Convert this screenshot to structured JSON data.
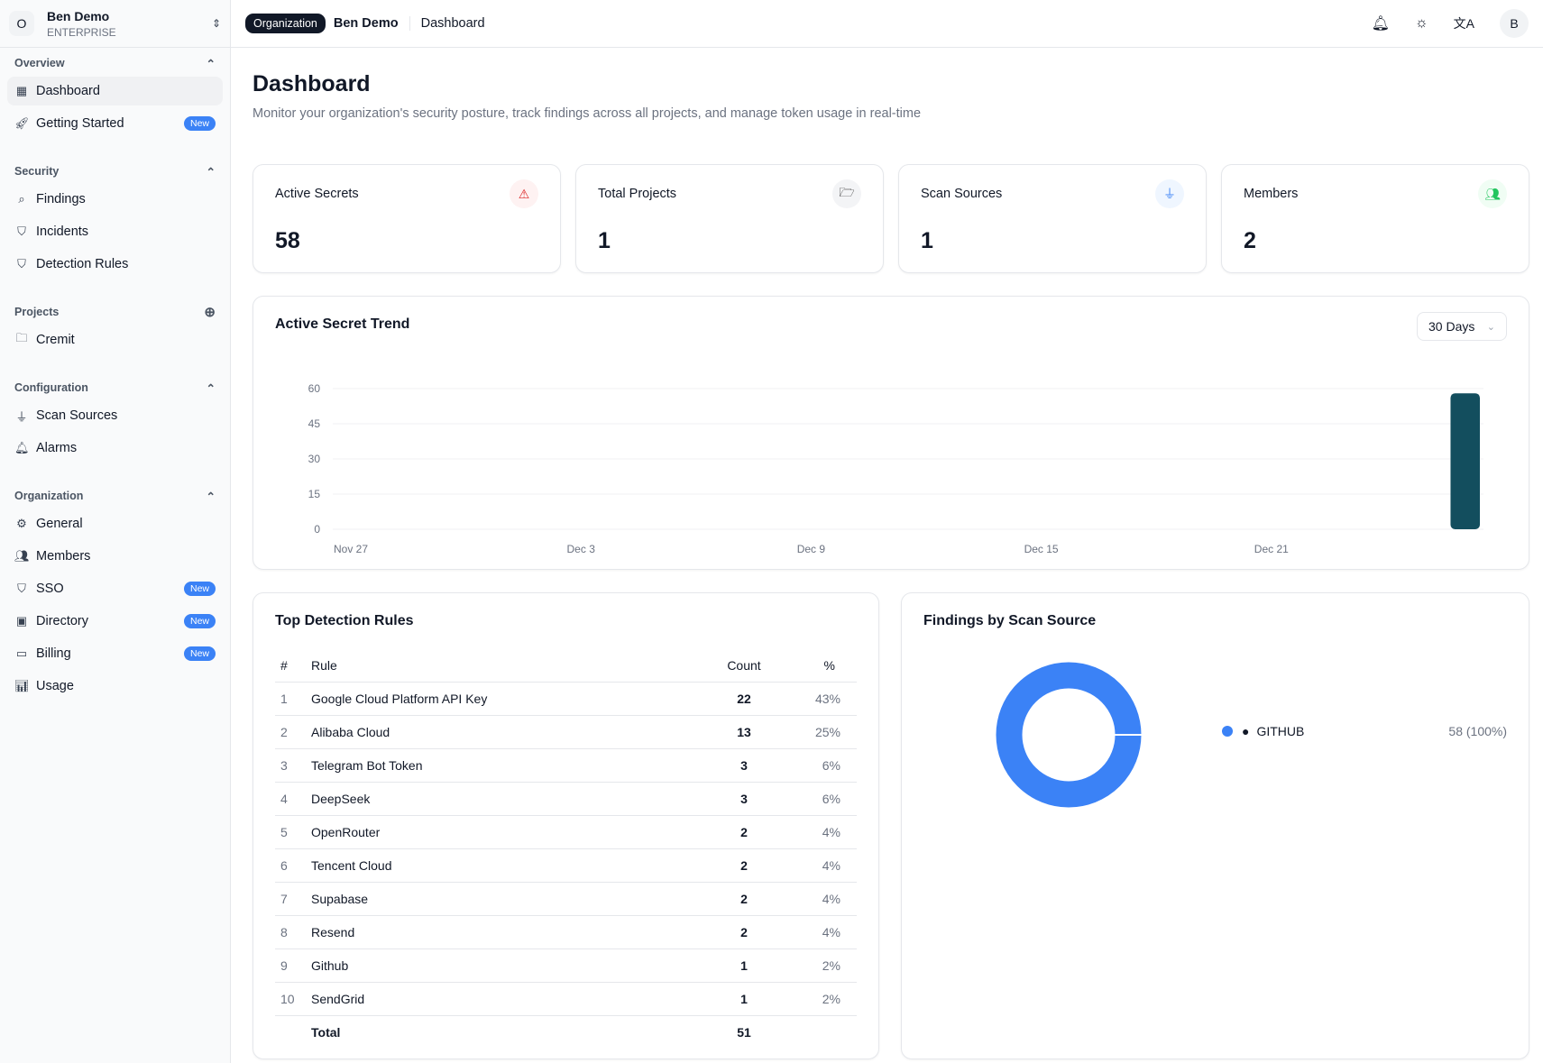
{
  "org": {
    "avatar": "O",
    "name": "Ben Demo",
    "plan": "ENTERPRISE"
  },
  "sidebar": {
    "overview": {
      "title": "Overview",
      "items": [
        {
          "label": "Dashboard"
        },
        {
          "label": "Getting Started",
          "badge": "New"
        }
      ]
    },
    "security": {
      "title": "Security",
      "items": [
        {
          "label": "Findings"
        },
        {
          "label": "Incidents"
        },
        {
          "label": "Detection Rules"
        }
      ]
    },
    "projects": {
      "title": "Projects",
      "items": [
        {
          "label": "Cremit"
        }
      ]
    },
    "configuration": {
      "title": "Configuration",
      "items": [
        {
          "label": "Scan Sources"
        },
        {
          "label": "Alarms"
        }
      ]
    },
    "organization": {
      "title": "Organization",
      "items": [
        {
          "label": "General"
        },
        {
          "label": "Members"
        },
        {
          "label": "SSO",
          "badge": "New"
        },
        {
          "label": "Directory",
          "badge": "New"
        },
        {
          "label": "Billing",
          "badge": "New"
        },
        {
          "label": "Usage"
        }
      ]
    }
  },
  "header": {
    "pill": "Organization",
    "org": "Ben Demo",
    "page": "Dashboard",
    "avatar": "B"
  },
  "page": {
    "title": "Dashboard",
    "subtitle": "Monitor your organization's security posture, track findings across all projects, and manage token usage in real-time"
  },
  "stats": [
    {
      "label": "Active Secrets",
      "value": "58"
    },
    {
      "label": "Total Projects",
      "value": "1"
    },
    {
      "label": "Scan Sources",
      "value": "1"
    },
    {
      "label": "Members",
      "value": "2"
    }
  ],
  "trend": {
    "title": "Active Secret Trend",
    "range": "30 Days"
  },
  "rules": {
    "title": "Top Detection Rules",
    "headers": [
      "#",
      "Rule",
      "Count",
      "%"
    ],
    "rows": [
      [
        "1",
        "Google Cloud Platform API Key",
        "22",
        "43%"
      ],
      [
        "2",
        "Alibaba Cloud",
        "13",
        "25%"
      ],
      [
        "3",
        "Telegram Bot Token",
        "3",
        "6%"
      ],
      [
        "4",
        "DeepSeek",
        "3",
        "6%"
      ],
      [
        "5",
        "OpenRouter",
        "2",
        "4%"
      ],
      [
        "6",
        "Tencent Cloud",
        "2",
        "4%"
      ],
      [
        "7",
        "Supabase",
        "2",
        "4%"
      ],
      [
        "8",
        "Resend",
        "2",
        "4%"
      ],
      [
        "9",
        "Github",
        "1",
        "2%"
      ],
      [
        "10",
        "SendGrid",
        "1",
        "2%"
      ]
    ],
    "total_label": "Total",
    "total": "51"
  },
  "findings": {
    "title": "Findings by Scan Source",
    "source": "GITHUB",
    "value": "58 (100%)"
  },
  "chart_data": [
    {
      "type": "bar",
      "title": "Active Secret Trend",
      "ylim": [
        0,
        60
      ],
      "yticks": [
        "0",
        "15",
        "30",
        "45",
        "60"
      ],
      "xticks": [
        "Nov 27",
        "Dec 3",
        "Dec 9",
        "Dec 15",
        "Dec 21"
      ],
      "x": [
        "Nov 27",
        "Nov 28",
        "Nov 29",
        "Nov 30",
        "Dec 1",
        "Dec 2",
        "Dec 3",
        "Dec 4",
        "Dec 5",
        "Dec 6",
        "Dec 7",
        "Dec 8",
        "Dec 9",
        "Dec 10",
        "Dec 11",
        "Dec 12",
        "Dec 13",
        "Dec 14",
        "Dec 15",
        "Dec 16",
        "Dec 17",
        "Dec 18",
        "Dec 19",
        "Dec 20",
        "Dec 21",
        "Dec 22",
        "Dec 23",
        "Dec 24",
        "Dec 25",
        "Dec 26"
      ],
      "values": [
        0,
        0,
        0,
        0,
        0,
        0,
        0,
        0,
        0,
        0,
        0,
        0,
        0,
        0,
        0,
        0,
        0,
        0,
        0,
        0,
        0,
        0,
        0,
        0,
        0,
        0,
        0,
        0,
        0,
        58
      ],
      "color": "#134e5e"
    },
    {
      "type": "pie",
      "title": "Findings by Scan Source",
      "labels": [
        "GITHUB"
      ],
      "values": [
        58
      ],
      "percent": [
        100
      ],
      "color": "#3b82f6"
    }
  ]
}
